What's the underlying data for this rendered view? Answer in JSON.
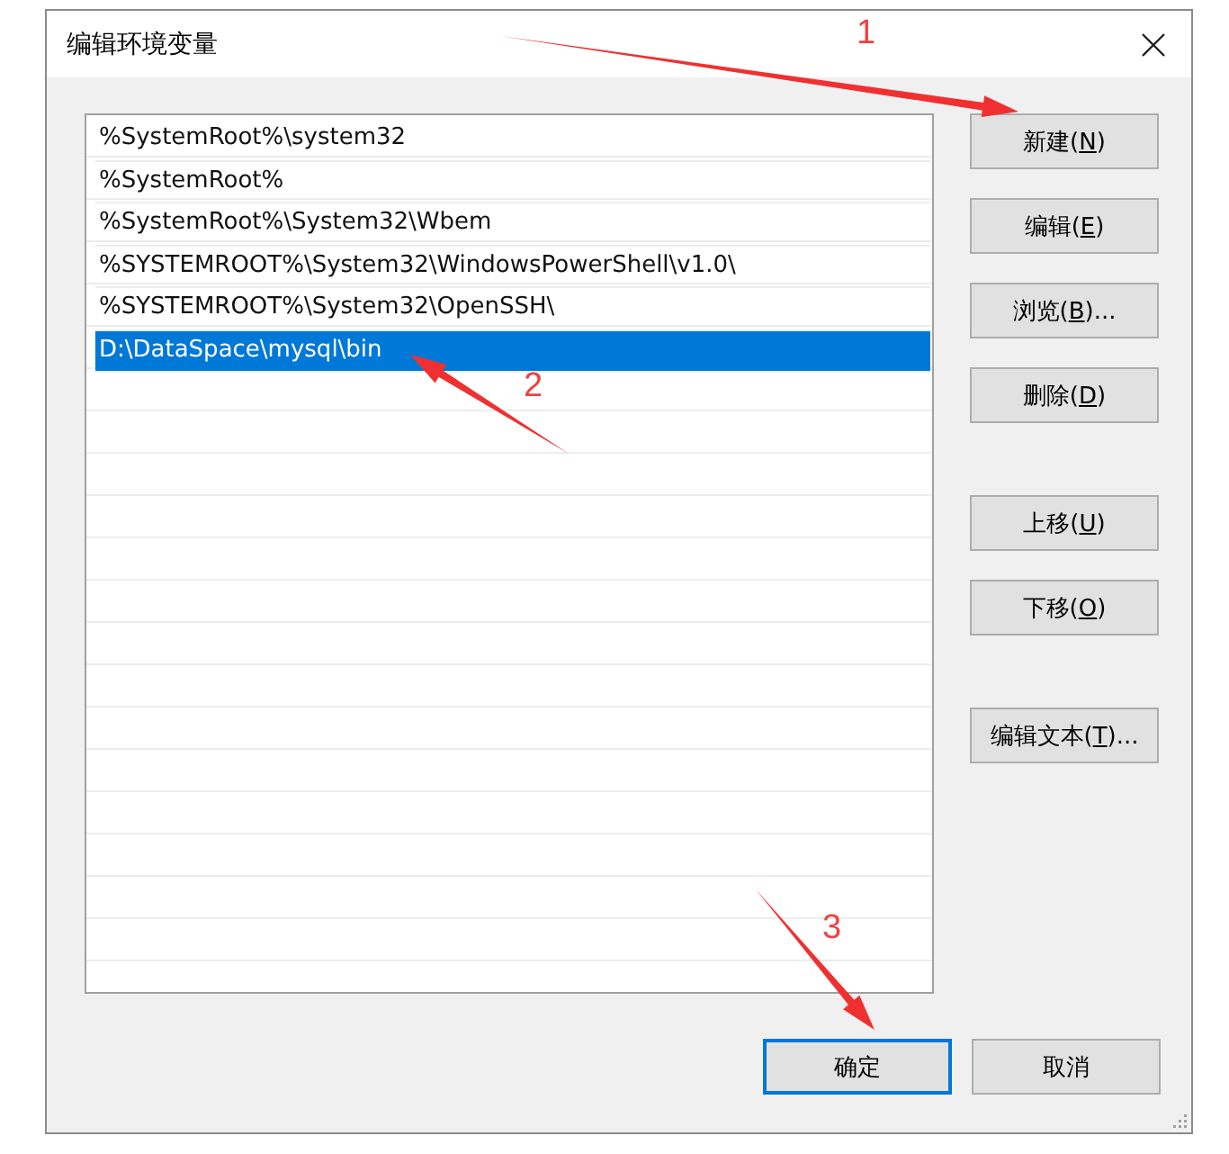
{
  "window": {
    "title": "编辑环境变量"
  },
  "list": [
    {
      "text": "%SystemRoot%\\system32",
      "selected": false
    },
    {
      "text": "%SystemRoot%",
      "selected": false
    },
    {
      "text": "%SystemRoot%\\System32\\Wbem",
      "selected": false
    },
    {
      "text": "%SYSTEMROOT%\\System32\\WindowsPowerShell\\v1.0\\",
      "selected": false
    },
    {
      "text": "%SYSTEMROOT%\\System32\\OpenSSH\\",
      "selected": false
    },
    {
      "text": "D:\\DataSpace\\mysql\\bin",
      "selected": true
    }
  ],
  "side_buttons": [
    [
      {
        "label": "新建(N)"
      },
      {
        "label": "编辑(E)"
      },
      {
        "label": "浏览(B)..."
      },
      {
        "label": "删除(D)"
      }
    ],
    [
      {
        "label": "上移(U)"
      },
      {
        "label": "下移(O)"
      }
    ],
    [
      {
        "label": "编辑文本(T)..."
      }
    ]
  ],
  "footer_buttons": [
    {
      "label": "确定",
      "default": true
    },
    {
      "label": "取消",
      "default": false
    }
  ],
  "annotations": [
    {
      "label": "1"
    },
    {
      "label": "2"
    },
    {
      "label": "3"
    }
  ]
}
